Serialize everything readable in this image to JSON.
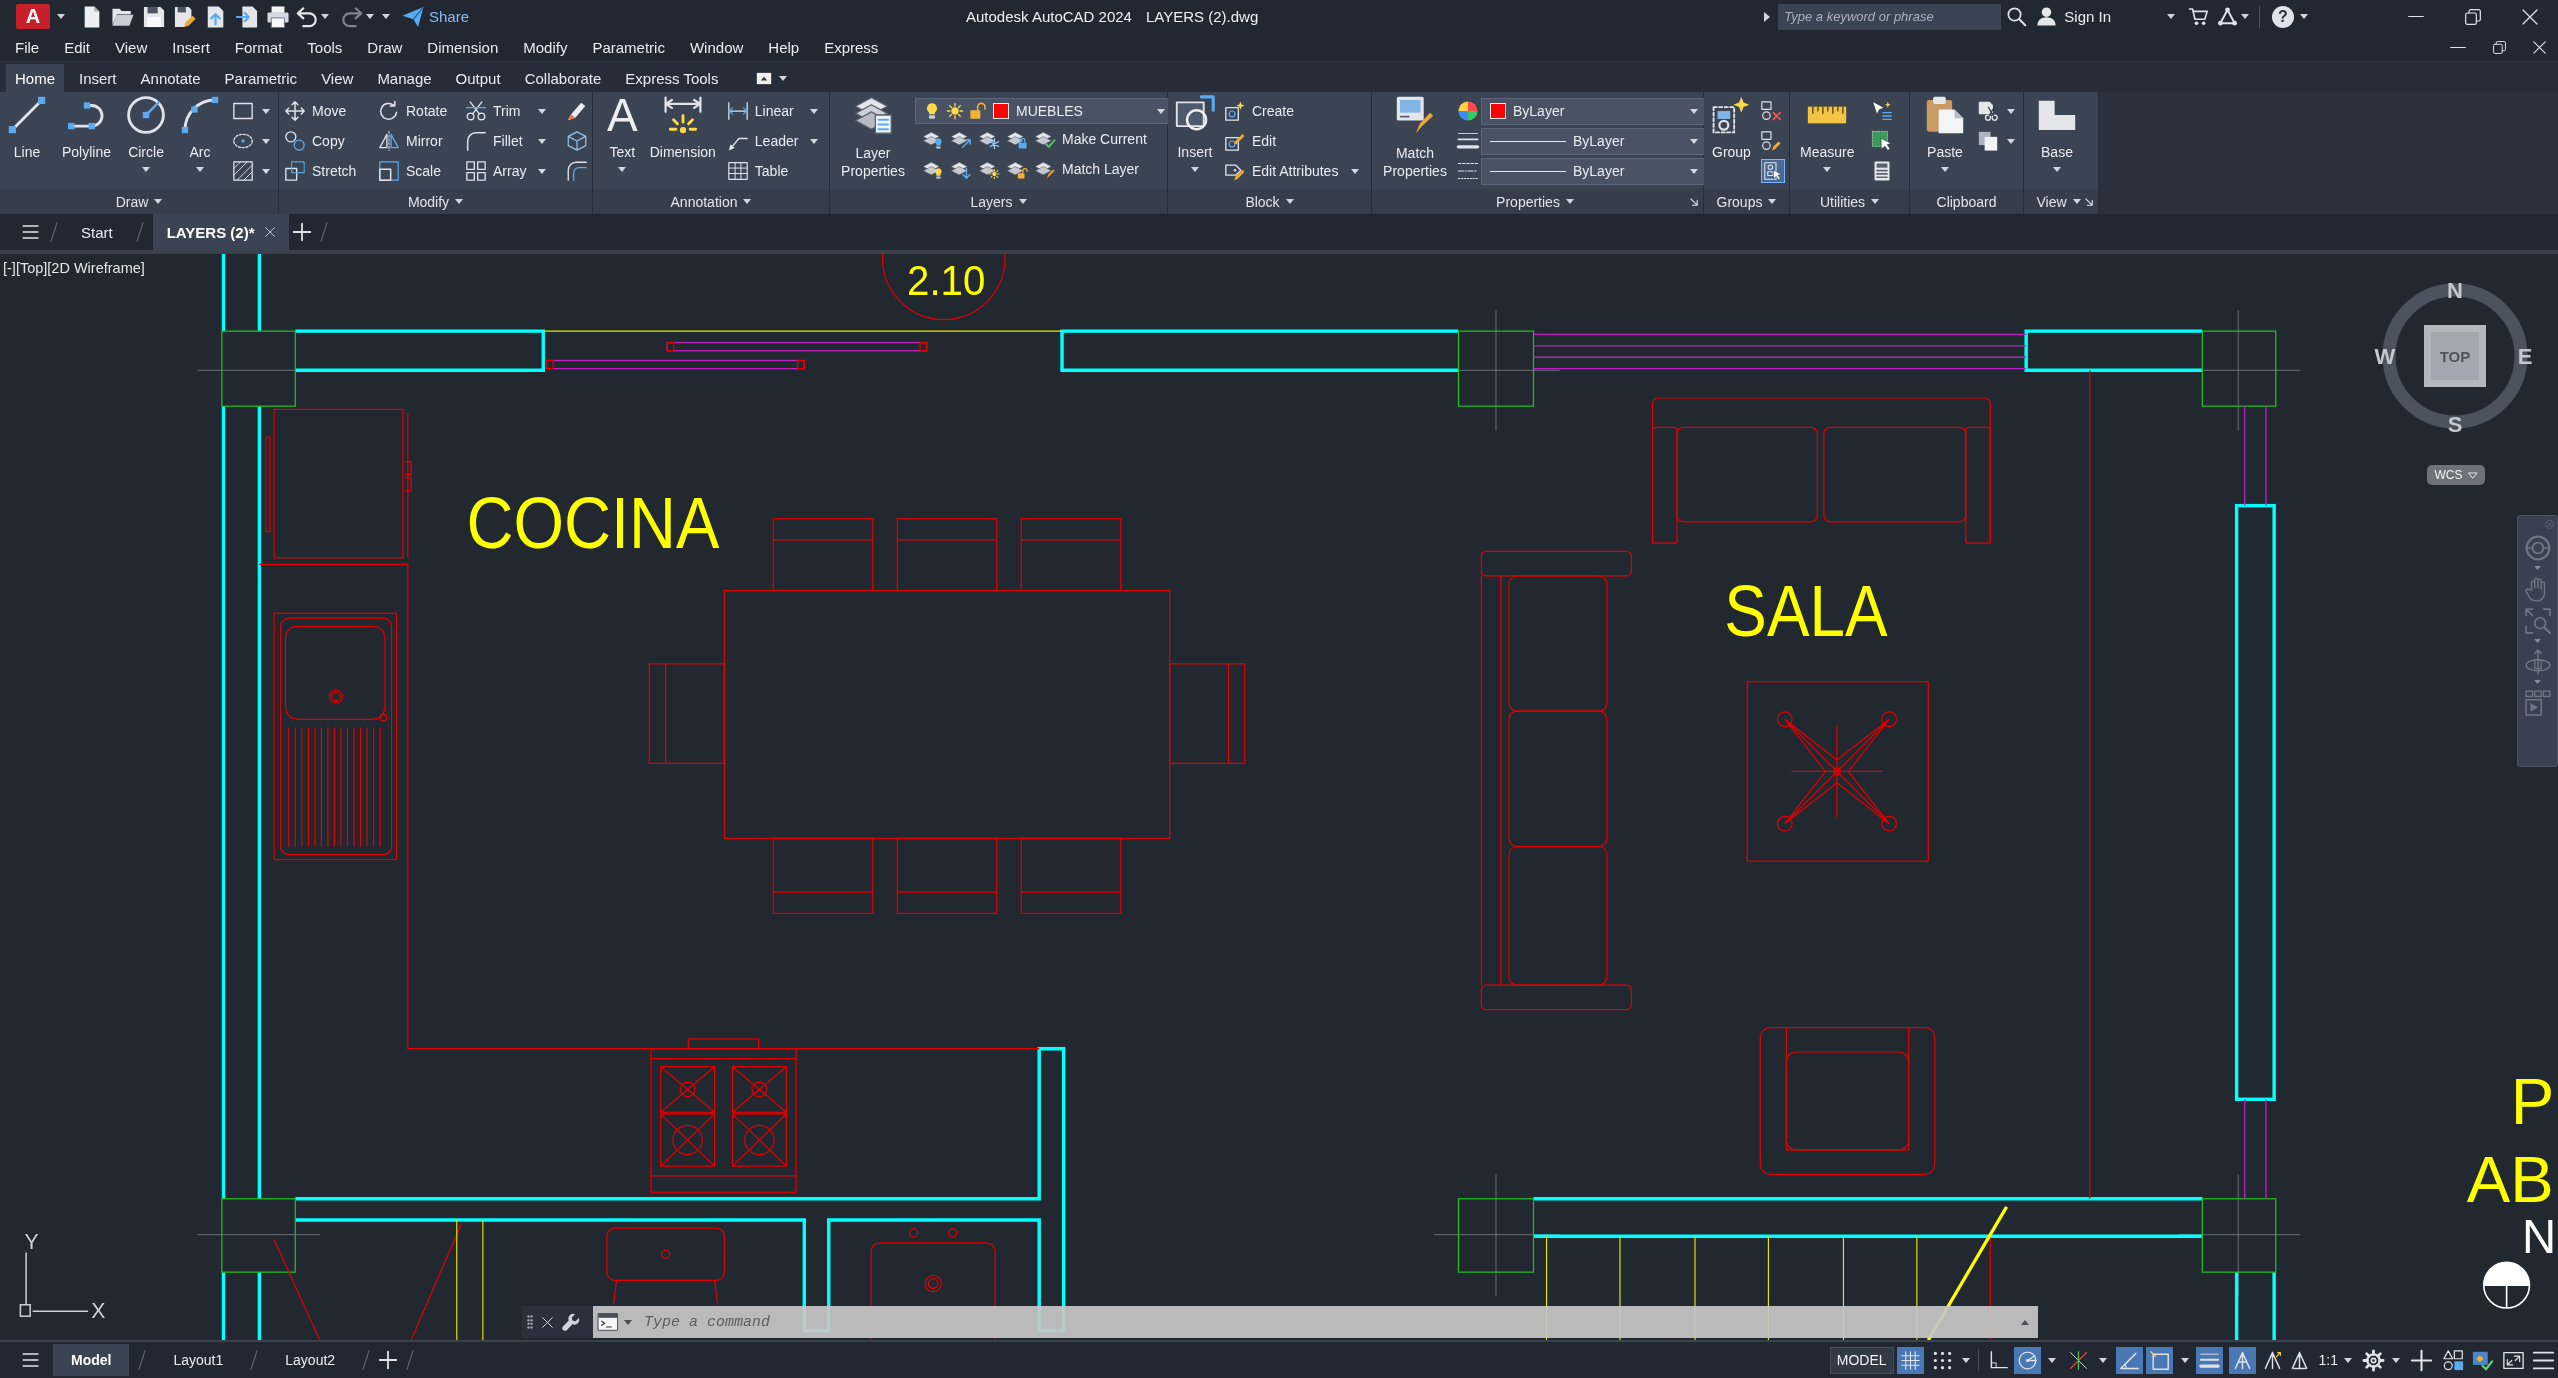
{
  "title_bar": {
    "app_button": {
      "glyph": "A"
    },
    "share": "Share",
    "title": "Autodesk AutoCAD 2024",
    "file": "LAYERS (2).dwg",
    "search": {
      "placeholder": "Type a keyword or phrase"
    },
    "sign_in": "Sign In",
    "help": {
      "glyph": "?"
    }
  },
  "menu_bar": [
    "File",
    "Edit",
    "View",
    "Insert",
    "Format",
    "Tools",
    "Draw",
    "Dimension",
    "Modify",
    "Parametric",
    "Window",
    "Help",
    "Express"
  ],
  "ribbon": {
    "tabs": [
      {
        "label": "Home",
        "selected": true
      },
      {
        "label": "Insert",
        "selected": false
      },
      {
        "label": "Annotate",
        "selected": false
      },
      {
        "label": "Parametric",
        "selected": false
      },
      {
        "label": "View",
        "selected": false
      },
      {
        "label": "Manage",
        "selected": false
      },
      {
        "label": "Output",
        "selected": false
      },
      {
        "label": "Collaborate",
        "selected": false
      },
      {
        "label": "Express Tools",
        "selected": false
      }
    ],
    "draw": {
      "title": "Draw",
      "tools": [
        "Line",
        "Polyline",
        "Circle",
        "Arc"
      ]
    },
    "modify": {
      "title": "Modify",
      "tools": [
        "Move",
        "Rotate",
        "Trim",
        "Copy",
        "Mirror",
        "Fillet",
        "Stretch",
        "Scale",
        "Array"
      ]
    },
    "annotation": {
      "title": "Annotation",
      "text_tool": {
        "glyph": "A",
        "label": "Text"
      },
      "tools": [
        "Dimension",
        "Linear",
        "Leader",
        "Table"
      ]
    },
    "layers": {
      "title": "Layers",
      "tools": [
        "Layer Properties",
        "Make Current",
        "Match Layer"
      ],
      "current_layer": {
        "name": "MUEBLES",
        "color": "#ff0000",
        "on": true,
        "frozen": false,
        "locked": false
      }
    },
    "block": {
      "title": "Block",
      "tools": [
        "Insert",
        "Create",
        "Edit",
        "Edit Attributes"
      ]
    },
    "properties": {
      "title": "Properties",
      "tools": [
        "Match Properties"
      ],
      "color": {
        "value": "ByLayer",
        "color": "#ff0000"
      },
      "lineweight": "ByLayer",
      "linetype": "ByLayer"
    },
    "groups": {
      "title": "Groups",
      "tools": [
        "Group"
      ],
      "group_selection": {
        "on": true
      }
    },
    "utilities": {
      "title": "Utilities",
      "tools": [
        "Measure"
      ]
    },
    "clipboard": {
      "title": "Clipboard",
      "tools": [
        "Paste"
      ]
    },
    "view": {
      "title": "View",
      "tools": [
        "Base"
      ]
    }
  },
  "file_tabs": [
    {
      "label": "Start",
      "selected": false
    },
    {
      "label": "LAYERS (2)*",
      "selected": true
    }
  ],
  "viewport": {
    "controls": "[-][Top][2D Wireframe]",
    "room_labels": [
      "COCINA",
      "SALA"
    ],
    "level_mark": "2.10",
    "edge_labels": [
      "P",
      "AB"
    ],
    "north_label": "N",
    "ucs_icon": {
      "y": "Y",
      "x": "X"
    },
    "view_cube": {
      "north": "N",
      "west": "W",
      "east": "E",
      "south": "S",
      "face": "TOP",
      "ucs_menu": "WCS"
    }
  },
  "command_line": {
    "placeholder": "Type a command"
  },
  "status_bar": {
    "layout_tabs": [
      {
        "label": "Model",
        "selected": true
      },
      {
        "label": "Layout1",
        "selected": false
      },
      {
        "label": "Layout2",
        "selected": false
      }
    ],
    "space": "MODEL",
    "toggles": [
      {
        "kind": "grid",
        "on": true
      },
      {
        "kind": "snap",
        "on": false
      },
      {
        "kind": "ortho",
        "on": false
      },
      {
        "kind": "polar",
        "on": true
      },
      {
        "kind": "isodraft",
        "on": false
      },
      {
        "kind": "object_tracking",
        "on": true
      },
      {
        "kind": "object_snap",
        "on": true
      },
      {
        "kind": "lineweight",
        "on": true
      },
      {
        "kind": "annotation_visibility",
        "on": true
      },
      {
        "kind": "annotation_autoscale",
        "on": false
      }
    ],
    "annotation_scale": "1:1"
  }
}
